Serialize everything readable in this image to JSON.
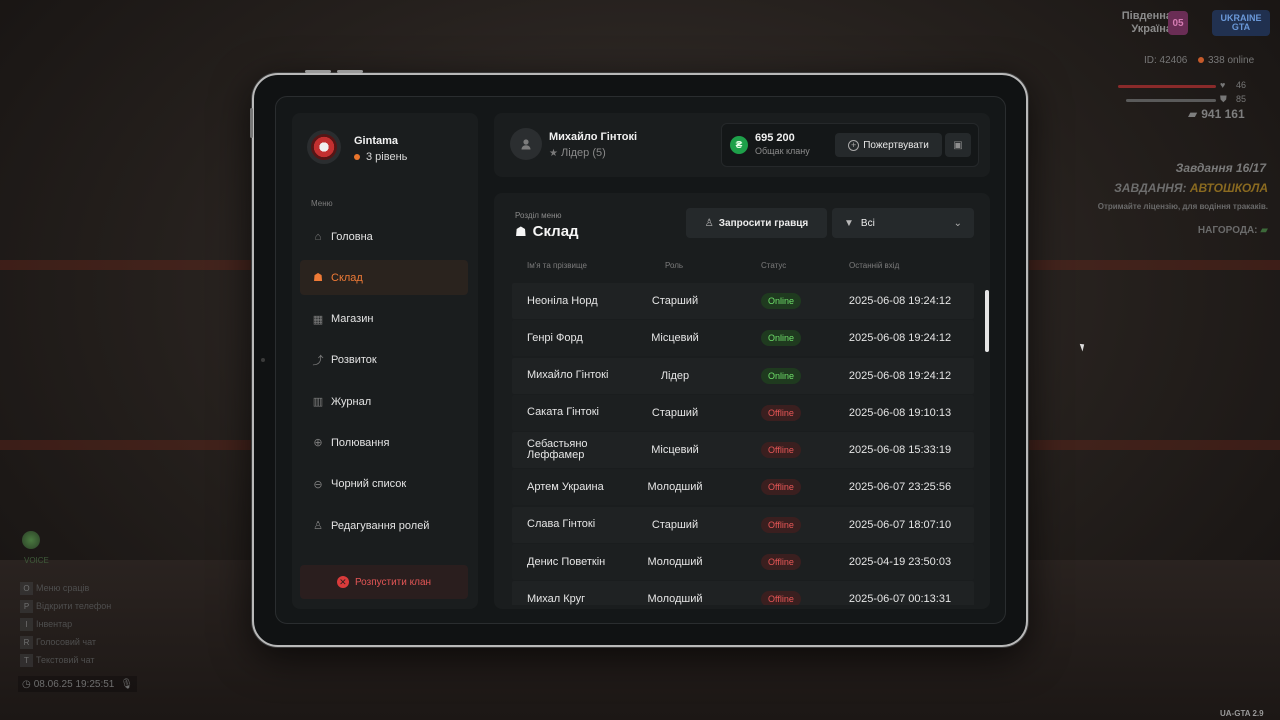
{
  "hud": {
    "server_line1": "Південна",
    "server_line2": "Україна",
    "server_num": "05",
    "logo": "UKRAINE GTA",
    "id": "ID: 42406",
    "online": "338 online",
    "health": "46",
    "armor": "85",
    "money": "941 161",
    "quest_num": "Завдання 16/17",
    "quest_title_prefix": "ЗАВДАННЯ:",
    "quest_title_value": "АВТОШКОЛА",
    "quest_desc": "Отримайте ліцензію, для водіння тракаків.",
    "quest_reward": "НАГОРОДА:",
    "mic_label": "VOICE",
    "hints": [
      {
        "key": "O",
        "label": "Меню сраців"
      },
      {
        "key": "P",
        "label": "Відкрити телефон"
      },
      {
        "key": "I",
        "label": "Інвентар"
      },
      {
        "key": "R",
        "label": "Голосовий чат"
      },
      {
        "key": "T",
        "label": "Текстовий чат"
      }
    ],
    "clock": "08.06.25 19:25:51",
    "version": "UA-GTA 2.9"
  },
  "sidebar": {
    "clan_name": "Gintama",
    "clan_level": "3 рівень",
    "menu_caption": "Меню",
    "items": [
      {
        "label": "Головна",
        "icon": "home-icon",
        "glyph": "⌂"
      },
      {
        "label": "Склад",
        "icon": "members-icon",
        "glyph": "☗"
      },
      {
        "label": "Магазин",
        "icon": "shop-icon",
        "glyph": "▦"
      },
      {
        "label": "Розвиток",
        "icon": "chart-icon",
        "glyph": "⤴"
      },
      {
        "label": "Журнал",
        "icon": "book-icon",
        "glyph": "▥"
      },
      {
        "label": "Полювання",
        "icon": "crosshair-icon",
        "glyph": "⊕"
      },
      {
        "label": "Чорний список",
        "icon": "block-icon",
        "glyph": "⊖"
      },
      {
        "label": "Редагування ролей",
        "icon": "role-edit-icon",
        "glyph": "♙"
      }
    ],
    "active_index": 1,
    "disband_label": "Розпустити клан"
  },
  "header": {
    "user_name": "Михайло Гінтокі",
    "user_role": "Лідер (5)",
    "money_value": "695 200",
    "money_label": "Общак клану",
    "donate_label": "Пожертвувати"
  },
  "main": {
    "section_caption": "Розділ меню",
    "section_title": "Склад",
    "invite_label": "Запросити гравця",
    "filter_value": "Всі",
    "columns": [
      "Ім'я та прізвище",
      "Роль",
      "Статус",
      "Останній вхід"
    ],
    "rows": [
      {
        "name": "Неоніла Норд",
        "role": "Старший",
        "status": "Online",
        "last": "2025-06-08 19:24:12"
      },
      {
        "name": "Генрі Форд",
        "role": "Місцевий",
        "status": "Online",
        "last": "2025-06-08 19:24:12"
      },
      {
        "name": "Михайло Гінтокі",
        "role": "Лідер",
        "status": "Online",
        "last": "2025-06-08 19:24:12"
      },
      {
        "name": "Саката Гінтокі",
        "role": "Старший",
        "status": "Offline",
        "last": "2025-06-08 19:10:13"
      },
      {
        "name": "Себастьяно Леффамер",
        "role": "Місцевий",
        "status": "Offline",
        "last": "2025-06-08 15:33:19"
      },
      {
        "name": "Артем Украина",
        "role": "Молодший",
        "status": "Offline",
        "last": "2025-06-07 23:25:56"
      },
      {
        "name": "Слава Гінтокі",
        "role": "Старший",
        "status": "Offline",
        "last": "2025-06-07 18:07:10"
      },
      {
        "name": "Денис Поветкін",
        "role": "Молодший",
        "status": "Offline",
        "last": "2025-04-19 23:50:03"
      },
      {
        "name": "Михал Круг",
        "role": "Молодший",
        "status": "Offline",
        "last": "2025-06-07 00:13:31"
      }
    ]
  },
  "colors": {
    "accent": "#ef7a36",
    "online": "#6fe06a",
    "offline": "#e85757",
    "money": "#1ea04a"
  }
}
